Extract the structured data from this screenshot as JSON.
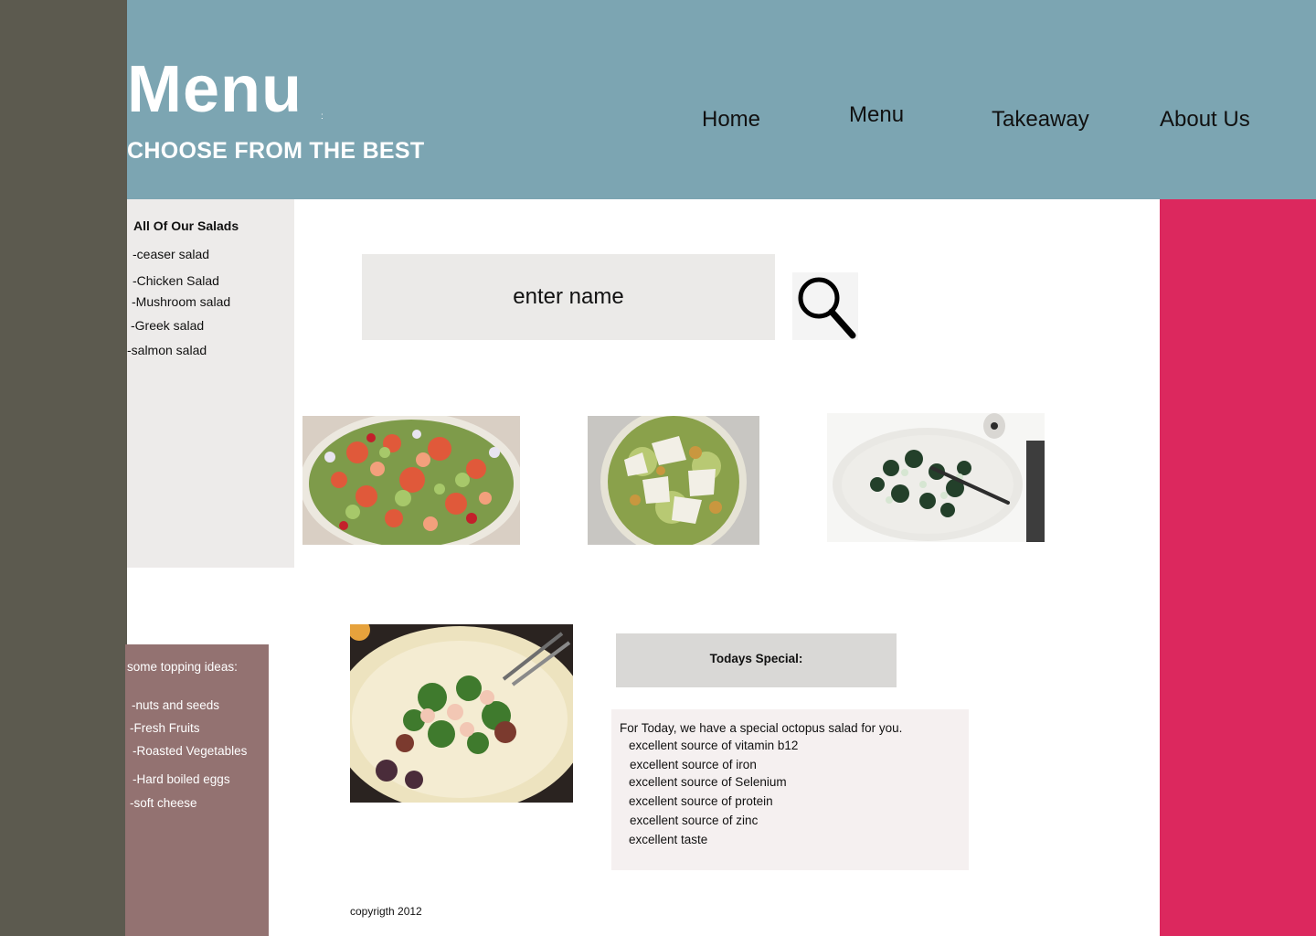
{
  "header": {
    "title": "Menu",
    "title_mark": ":",
    "subtitle": "CHOOSE FROM THE BEST",
    "background_color": "#7ca5b2"
  },
  "nav": {
    "items": [
      {
        "label": "Home"
      },
      {
        "label": "Menu"
      },
      {
        "label": "Takeaway"
      },
      {
        "label": "About Us"
      }
    ]
  },
  "salads": {
    "heading": "All Of Our Salads",
    "items": [
      {
        "label": "-ceaser salad"
      },
      {
        "label": "-Chicken Salad"
      },
      {
        "label": "-Mushroom salad"
      },
      {
        "label": "-Greek salad"
      },
      {
        "label": "-salmon salad"
      }
    ]
  },
  "search": {
    "placeholder": "enter name",
    "value": "",
    "icon": "search-icon"
  },
  "photos": [
    {
      "name": "salmon-salad-photo"
    },
    {
      "name": "caesar-salad-photo"
    },
    {
      "name": "mushroom-salad-photo"
    },
    {
      "name": "octopus-salad-photo"
    }
  ],
  "toppings": {
    "heading": "some topping ideas:",
    "items": [
      {
        "label": "-nuts and seeds"
      },
      {
        "label": "-Fresh Fruits"
      },
      {
        "label": "-Roasted Vegetables"
      },
      {
        "label": "-Hard boiled eggs"
      },
      {
        "label": "-soft cheese"
      }
    ]
  },
  "special": {
    "label": "Todays Special:",
    "intro": "For Today, we have a special octopus salad for you.",
    "lines": [
      "excellent source of vitamin b12",
      "excellent source of iron",
      "excellent source of  Selenium",
      "excellent source of protein",
      "excellent source of zinc",
      "excellent taste"
    ]
  },
  "footer": {
    "copyright": "copyrigth 2012"
  },
  "colors": {
    "left_strip": "#5c5a4f",
    "right_strip": "#dc285e",
    "salads_panel": "#edebea",
    "toppings_panel": "#937271",
    "special_header": "#d9d8d6",
    "special_box": "#f5f0f0"
  }
}
